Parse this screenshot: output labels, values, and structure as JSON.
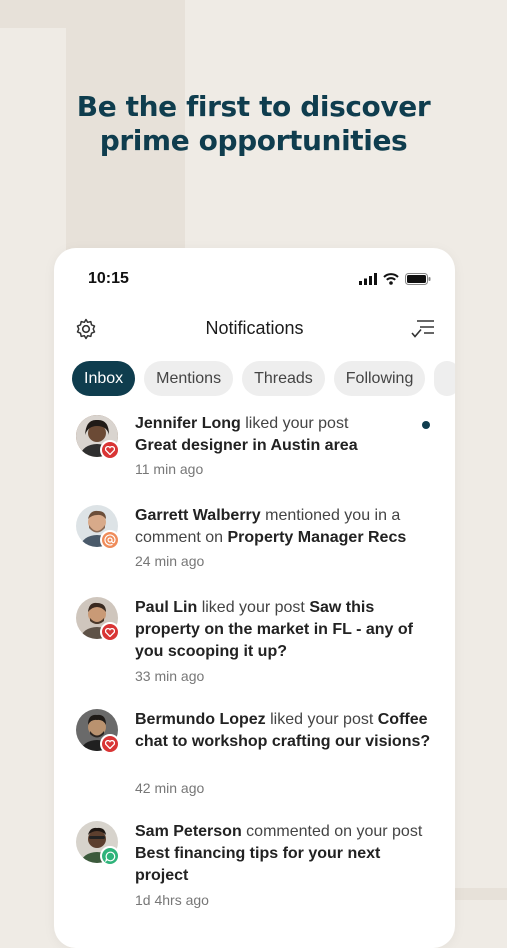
{
  "promo": {
    "headline_line1": "Be the first to discover",
    "headline_line2": "prime opportunities"
  },
  "status_bar": {
    "time": "10:15",
    "icons": [
      "cellular-signal-icon",
      "wifi-icon",
      "battery-icon"
    ]
  },
  "nav": {
    "title": "Notifications",
    "left_icon": "gear-icon",
    "right_icon": "mark-all-read-icon"
  },
  "tabs": [
    {
      "label": "Inbox",
      "active": true
    },
    {
      "label": "Mentions",
      "active": false
    },
    {
      "label": "Threads",
      "active": false
    },
    {
      "label": "Following",
      "active": false
    }
  ],
  "notifications": [
    {
      "name": "Jennifer Long",
      "action": "liked your post",
      "subject": "Great designer in Austin area",
      "time": "11 min ago",
      "badge": "heart-icon",
      "unread": true
    },
    {
      "name": "Garrett Walberry",
      "action": "mentioned you in a comment on",
      "subject": "Property Manager Recs",
      "time": "24 min ago",
      "badge": "at-sign-icon",
      "unread": false
    },
    {
      "name": "Paul Lin",
      "action": "liked your post",
      "subject": "Saw this property on the market in FL - any of you scooping it up?",
      "time": "33 min ago",
      "badge": "heart-icon",
      "unread": false
    },
    {
      "name": "Bermundo Lopez",
      "action": "liked your post",
      "subject": "Coffee chat to workshop crafting our visions?",
      "time": "42 min ago",
      "badge": "heart-icon",
      "unread": false
    },
    {
      "name": "Sam Peterson",
      "action": "commented on your post",
      "subject": "Best financing tips for your next project",
      "time": "1d 4hrs ago",
      "badge": "comment-icon",
      "unread": false
    }
  ],
  "colors": {
    "background": "#efebe5",
    "brand": "#0f3d4e",
    "like_badge": "#d93535",
    "mention_badge": "#ef8c5a",
    "comment_badge": "#2fb37a"
  }
}
